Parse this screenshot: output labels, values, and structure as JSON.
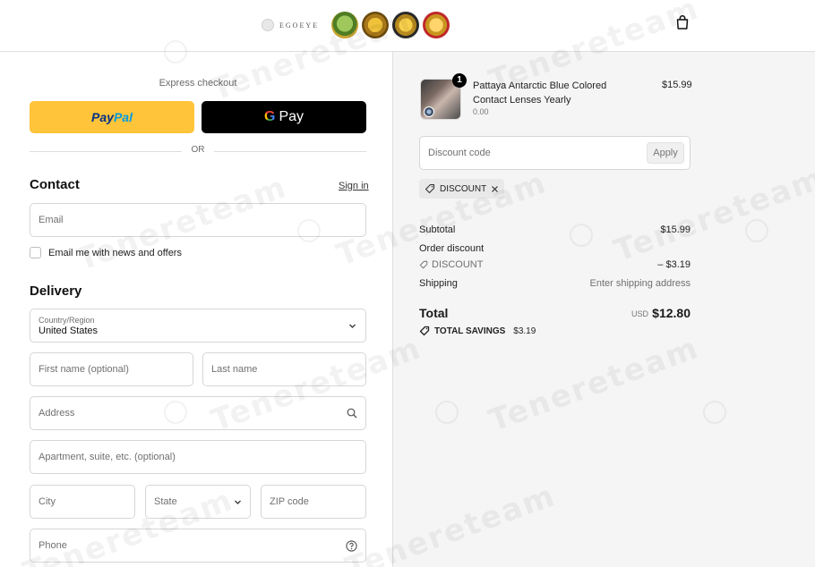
{
  "header": {
    "logo_text": "EGOEYE",
    "badges": [
      "green-seal-badge",
      "gold-seal-badge",
      "gold-quality-badge",
      "red-100-percent-badge"
    ],
    "cart_icon": "shopping-bag-icon"
  },
  "express": {
    "label": "Express checkout",
    "paypal_part1": "Pay",
    "paypal_part2": "Pal",
    "gpay_g": "G",
    "gpay_label": "Pay",
    "or_label": "OR"
  },
  "contact": {
    "title": "Contact",
    "signin_label": "Sign in",
    "email_placeholder": "Email",
    "newsletter_label": "Email me with news and offers"
  },
  "delivery": {
    "title": "Delivery",
    "country_label": "Country/Region",
    "country_value": "United States",
    "first_name_placeholder": "First name (optional)",
    "last_name_placeholder": "Last name",
    "address_placeholder": "Address",
    "apartment_placeholder": "Apartment, suite, etc. (optional)",
    "city_placeholder": "City",
    "state_placeholder": "State",
    "zip_placeholder": "ZIP code",
    "phone_placeholder": "Phone"
  },
  "order": {
    "product": {
      "name": "Pattaya Antarctic Blue Colored Contact Lenses Yearly",
      "variant": "0.00",
      "price": "$15.99",
      "quantity": "1"
    },
    "discount_placeholder": "Discount code",
    "apply_label": "Apply",
    "applied_code": "DISCOUNT",
    "subtotal_label": "Subtotal",
    "subtotal_value": "$15.99",
    "order_discount_label": "Order discount",
    "discount_code_label": "DISCOUNT",
    "discount_value": "– $3.19",
    "shipping_label": "Shipping",
    "shipping_value": "Enter shipping address",
    "total_label": "Total",
    "total_currency": "USD",
    "total_value": "$12.80",
    "savings_label": "TOTAL SAVINGS",
    "savings_value": "$3.19"
  },
  "watermark": {
    "text": "Tenereteam"
  },
  "colors": {
    "paypal_yellow": "#ffc439",
    "gpay_black": "#000000",
    "summary_bg": "#f5f5f5"
  }
}
